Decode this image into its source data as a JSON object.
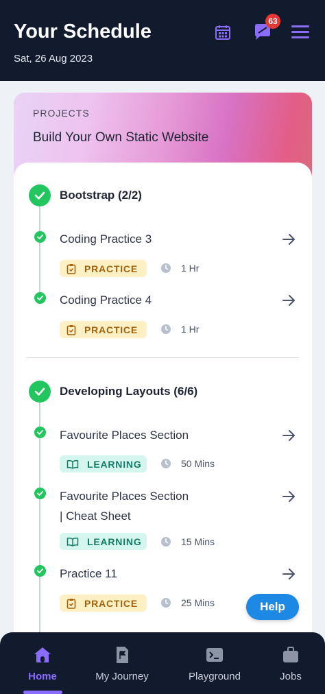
{
  "header": {
    "title": "Your Schedule",
    "date": "Sat, 26 Aug 2023",
    "notification_count": "63"
  },
  "project": {
    "label": "PROJECTS",
    "title": "Build Your Own Static Website"
  },
  "sections": [
    {
      "title": "Bootstrap (2/2)",
      "items": [
        {
          "title": "Coding Practice 3",
          "tag": "PRACTICE",
          "duration": "1 Hr"
        },
        {
          "title": "Coding Practice 4",
          "tag": "PRACTICE",
          "duration": "1 Hr"
        }
      ]
    },
    {
      "title": "Developing Layouts (6/6)",
      "items": [
        {
          "title": "Favourite Places Section",
          "tag": "LEARNING",
          "duration": "50 Mins"
        },
        {
          "title_line1": "Favourite Places Section",
          "title_line2": "| Cheat Sheet",
          "tag": "LEARNING",
          "duration": "15 Mins"
        },
        {
          "title": "Practice 11",
          "tag": "PRACTICE",
          "duration": "25 Mins"
        }
      ]
    }
  ],
  "help_button": "Help",
  "nav": [
    {
      "label": "Home"
    },
    {
      "label": "My Journey"
    },
    {
      "label": "Playground"
    },
    {
      "label": "Jobs"
    }
  ],
  "colors": {
    "header_bg": "#121a2e",
    "accent": "#8a6cff",
    "success": "#22c55e",
    "practice_bg": "#fdf0c5",
    "learning_bg": "#d5f6ee",
    "help_bg": "#1e88e5"
  }
}
